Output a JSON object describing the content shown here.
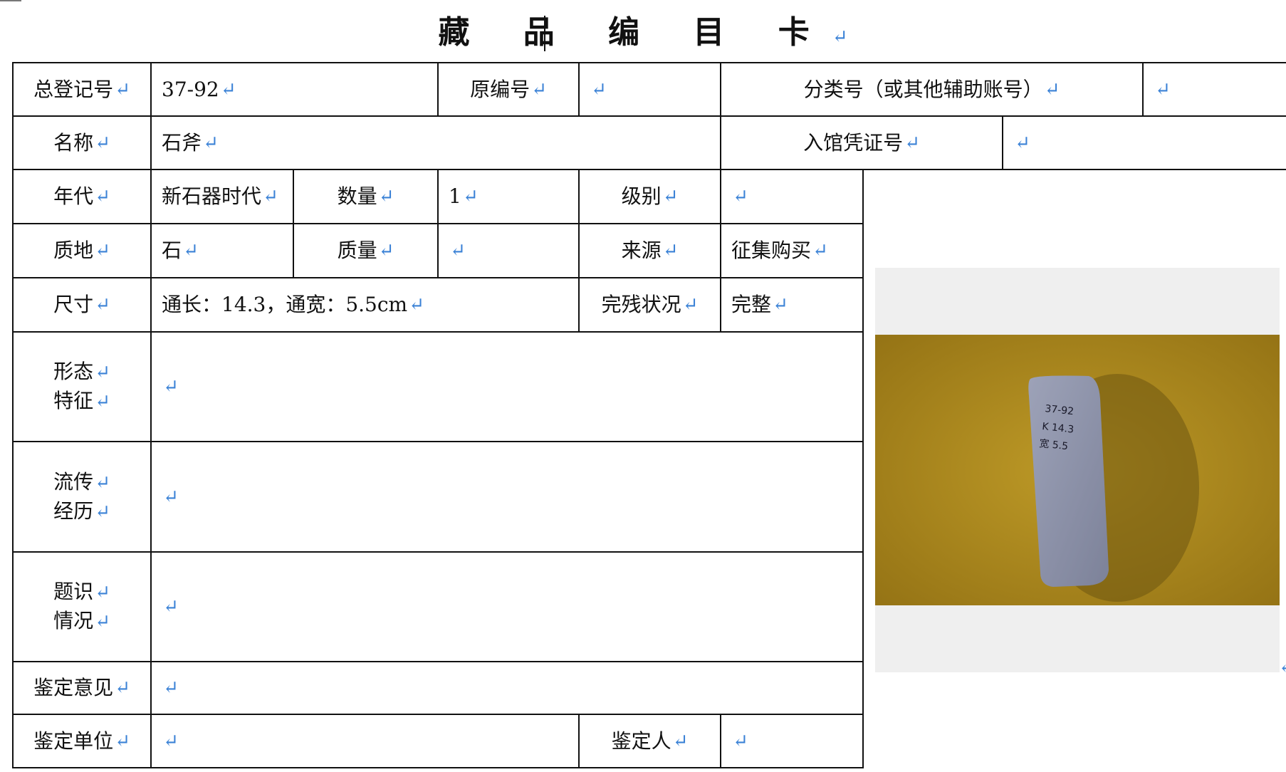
{
  "title": "藏 品 编 目 卡",
  "para_mark": "↵",
  "row1": {
    "reg_no_label": "总登记号",
    "reg_no_value": "37-92",
    "orig_no_label": "原编号",
    "orig_no_value": "",
    "class_no_label": "分类号（或其他辅助账号）",
    "class_no_value": ""
  },
  "row2": {
    "name_label": "名称",
    "name_value": "石斧",
    "voucher_label": "入馆凭证号",
    "voucher_value": ""
  },
  "row3": {
    "era_label": "年代",
    "era_value": "新石器时代",
    "qty_label": "数量",
    "qty_value": "1",
    "grade_label": "级别",
    "grade_value": ""
  },
  "row4": {
    "material_label": "质地",
    "material_value": "石",
    "weight_label": "质量",
    "weight_value": "",
    "source_label": "来源",
    "source_value": "征集购买"
  },
  "row5": {
    "size_label": "尺寸",
    "size_value": "通长：14.3，通宽：5.5cm",
    "condition_label": "完残状况",
    "condition_value": "完整"
  },
  "row6": {
    "label_l1": "形态",
    "label_l2": "特征",
    "value": ""
  },
  "row7": {
    "label_l1": "流传",
    "label_l2": "经历",
    "value": ""
  },
  "row8": {
    "label_l1": "题识",
    "label_l2": "情况",
    "value": ""
  },
  "row9": {
    "opinion_label": "鉴定意见",
    "opinion_value": ""
  },
  "row10": {
    "unit_label": "鉴定单位",
    "unit_value": "",
    "appraiser_label": "鉴定人",
    "appraiser_value": ""
  },
  "photo": {
    "tag_lines": [
      "37-92",
      "K 14.3",
      "宽 5.5"
    ],
    "background_color": "#b3901e",
    "stone_color": "#8a8fa6"
  }
}
